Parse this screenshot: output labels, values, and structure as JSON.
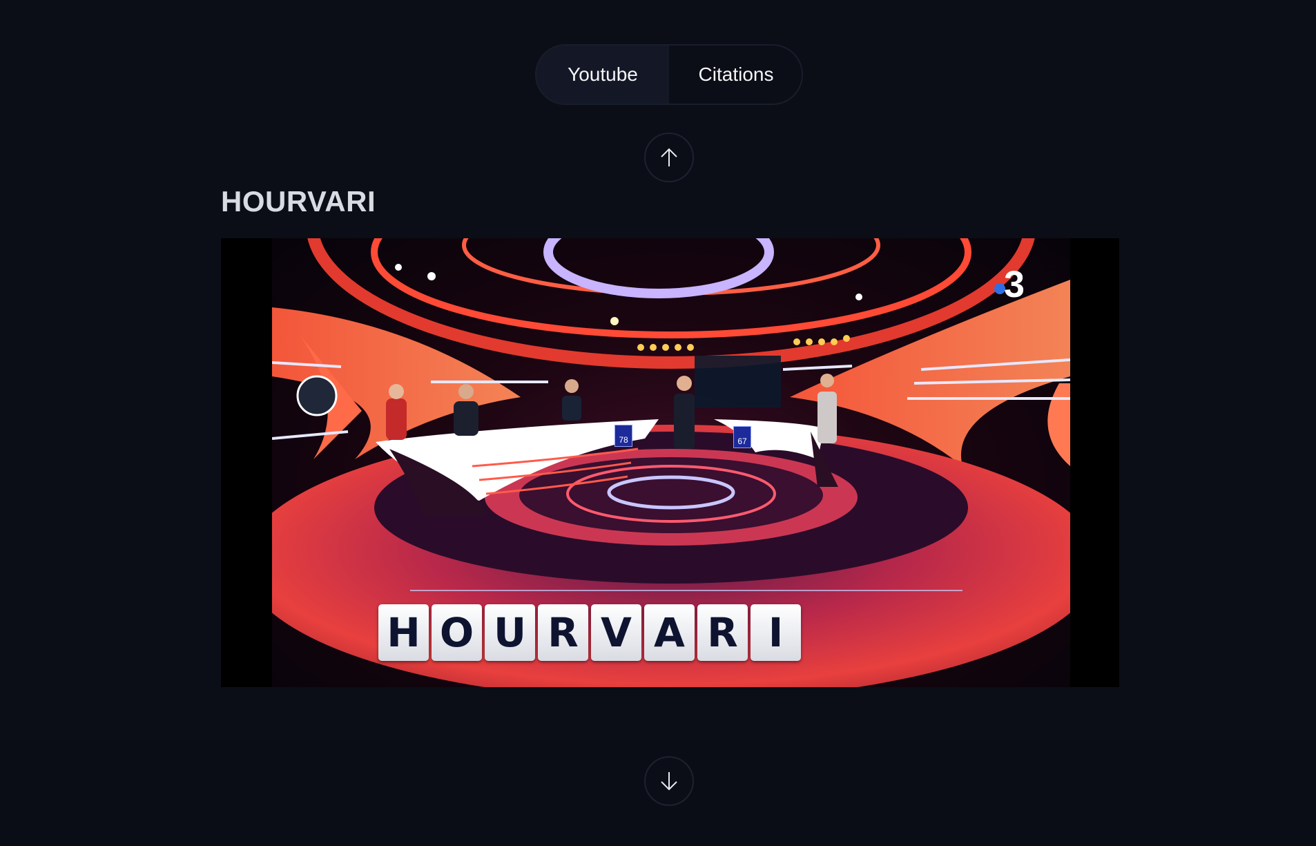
{
  "tabs": [
    {
      "label": "Youtube",
      "active": true
    },
    {
      "label": "Citations",
      "active": false
    }
  ],
  "nav": {
    "up_icon": "arrow-up-icon",
    "down_icon": "arrow-down-icon"
  },
  "video": {
    "title": "HOURVARI",
    "letters": [
      "H",
      "O",
      "U",
      "R",
      "V",
      "A",
      "R",
      "I"
    ],
    "channel": "3",
    "scores": [
      "78",
      "67"
    ]
  },
  "colors": {
    "background": "#0b0e17",
    "tab_active": "#141826",
    "title": "#d9dbe2",
    "channel_dot": "#2f6fe4"
  }
}
